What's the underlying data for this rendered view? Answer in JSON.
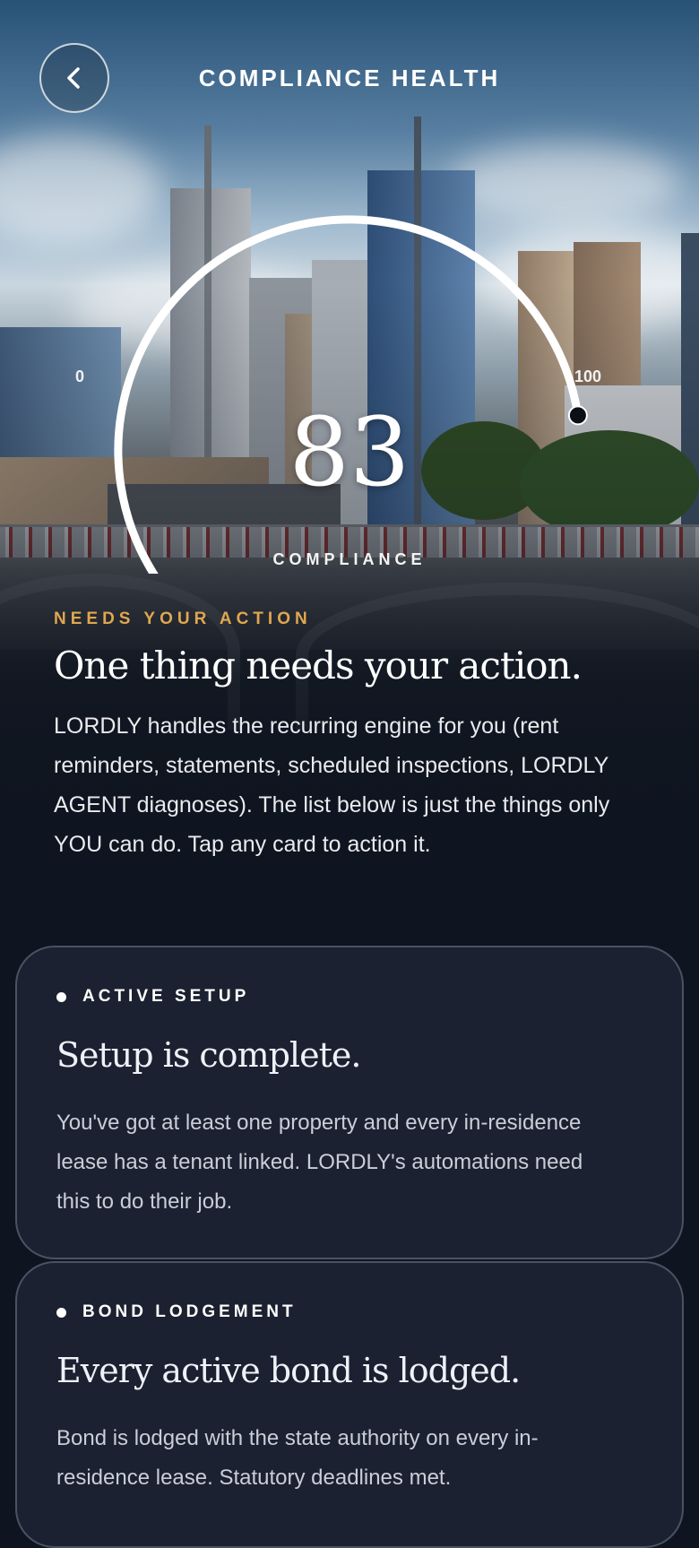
{
  "header": {
    "title": "COMPLIANCE HEALTH"
  },
  "gauge": {
    "min_label": "0",
    "max_label": "100",
    "score": "83",
    "score_value": 83,
    "caption": "COMPLIANCE"
  },
  "intro": {
    "eyebrow": "NEEDS YOUR ACTION",
    "headline": "One thing needs your action.",
    "body": "LORDLY handles the recurring engine for you (rent reminders, statements, scheduled inspections, LORDLY AGENT diagnoses). The list below is just the things only YOU can do. Tap any card to action it."
  },
  "cards": [
    {
      "tag": "ACTIVE SETUP",
      "title": "Setup is complete.",
      "body": "You've got at least one property and every in-residence lease has a tenant linked. LORDLY's automations need this to do their job."
    },
    {
      "tag": "BOND LODGEMENT",
      "title": "Every active bond is lodged.",
      "body": "Bond is lodged with the state authority on every in-residence lease. Statutory deadlines met."
    }
  ],
  "icons": {
    "back": "chevron-left-icon",
    "status": "dot-icon"
  }
}
